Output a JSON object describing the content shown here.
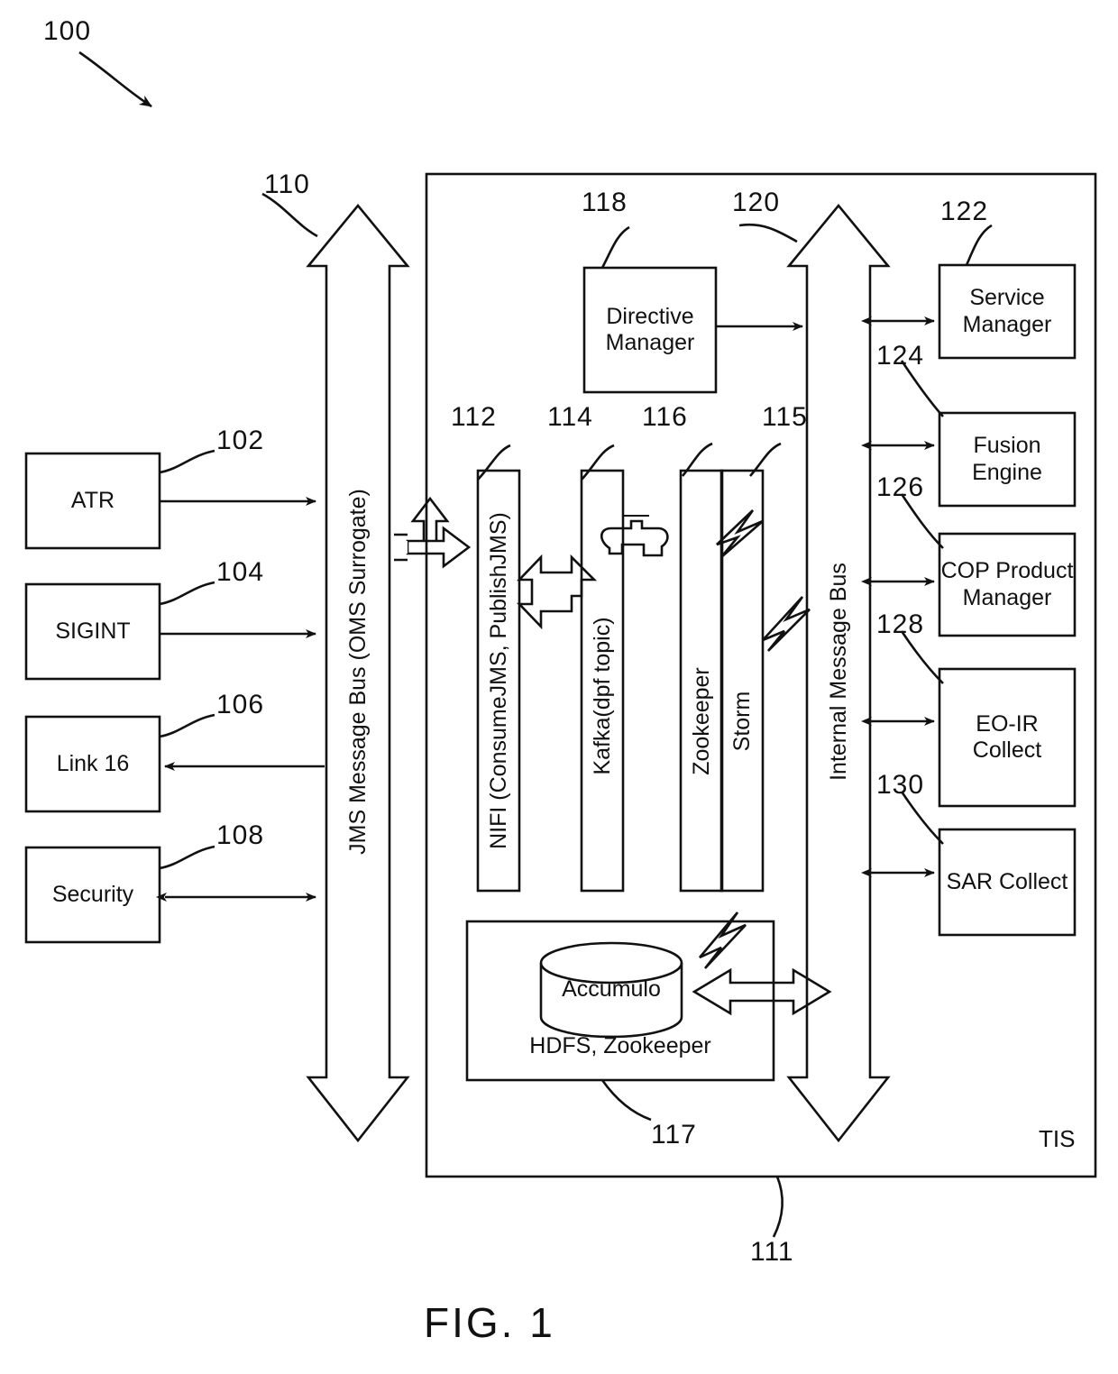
{
  "figure": {
    "caption": "FIG. 1",
    "system_ref": "100",
    "container_ref": "111",
    "container_label": "TIS"
  },
  "external_sources": {
    "items": [
      {
        "label": "ATR",
        "ref": "102",
        "arrow": "right"
      },
      {
        "label": "SIGINT",
        "ref": "104",
        "arrow": "right"
      },
      {
        "label": "Link  16",
        "ref": "106",
        "arrow": "left"
      },
      {
        "label": "Security",
        "ref": "108",
        "arrow": "both"
      }
    ]
  },
  "buses": [
    {
      "name": "jms_bus",
      "label": "JMS Message Bus (OMS Surrogate)",
      "ref": "110"
    },
    {
      "name": "internal_bus",
      "label": "Internal Message Bus",
      "ref": "120"
    }
  ],
  "pipeline": {
    "items": [
      {
        "label": "NIFI (ConsumeJMS, PublishJMS)",
        "ref": "112"
      },
      {
        "label": "Kafka(dpf topic)",
        "ref": "114"
      },
      {
        "label": "Zookeeper",
        "ref": "116"
      },
      {
        "label": "Storm",
        "ref": "115"
      }
    ]
  },
  "directive_manager": {
    "label": "Directive Manager",
    "ref": "118"
  },
  "storage": {
    "ref": "117",
    "db_label": "Accumulo",
    "platform_label": "HDFS,  Zookeeper"
  },
  "services": {
    "items": [
      {
        "label": "Service Manager",
        "ref": "122"
      },
      {
        "label": "Fusion Engine",
        "ref": "124"
      },
      {
        "label": "COP Product Manager",
        "ref": "126"
      },
      {
        "label": "EO-IR Collect",
        "ref": "128"
      },
      {
        "label": "SAR Collect",
        "ref": "130"
      }
    ]
  },
  "icons": {
    "spout": "spout-icon",
    "bolt": "lightning-bolt-icon"
  },
  "colors": {
    "line": "#111111",
    "fill": "#ffffff"
  }
}
